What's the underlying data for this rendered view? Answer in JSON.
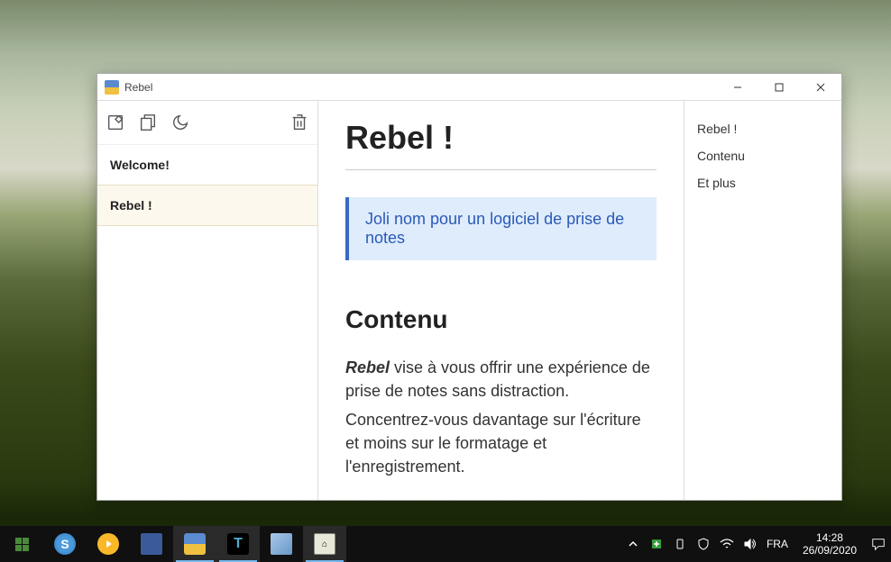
{
  "window": {
    "title": "Rebel"
  },
  "sidebar": {
    "notes": [
      {
        "title": "Welcome!",
        "selected": false
      },
      {
        "title": "Rebel !",
        "selected": true
      }
    ]
  },
  "content": {
    "h1": "Rebel !",
    "quote": "Joli nom pour un logiciel de prise de notes",
    "h2": "Contenu",
    "p1_em": "Rebel",
    "p1_rest": " vise à vous offrir une expérience de prise de notes sans distraction.",
    "p2": "Concentrez-vous davantage sur l'écriture et moins sur le formatage et l'enregistrement."
  },
  "outline": {
    "items": [
      "Rebel !",
      "Contenu",
      "Et plus"
    ]
  },
  "taskbar": {
    "tray": {
      "lang": "FRA",
      "time": "14:28",
      "date": "26/09/2020"
    }
  }
}
